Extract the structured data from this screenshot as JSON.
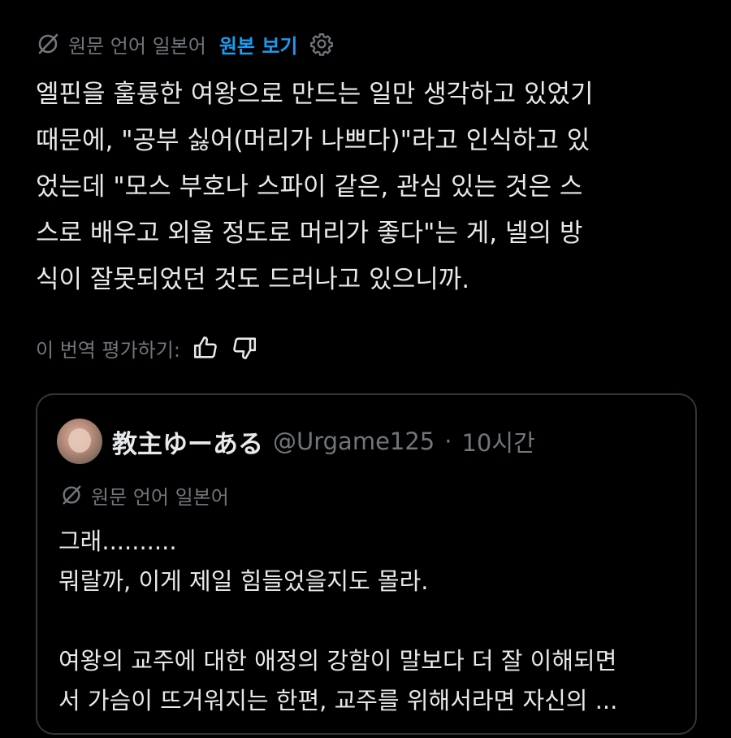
{
  "translation": {
    "source_label": "원문 언어 일본어",
    "show_original": "원본 보기",
    "icon": "translate-off-icon",
    "settings_icon": "gear-icon"
  },
  "tweet": {
    "text": "엘핀을 훌륭한 여왕으로 만드는 일만 생각하고 있었기\n때문에, \"공부 싫어(머리가 나쁘다)\"라고 인식하고 있\n었는데 \"모스 부호나 스파이 같은, 관심 있는 것은 스\n스로 배우고 외울 정도로 머리가 좋다\"는 게, 넬의 방\n식이 잘못되었던 것도 드러나고 있으니까."
  },
  "rating": {
    "label": "이 번역 평가하기:",
    "like_icon": "thumbs-up-icon",
    "dislike_icon": "thumbs-down-icon"
  },
  "quote": {
    "display_name": "教主ゆーある",
    "handle": "@Urgame125",
    "separator": "·",
    "time": "10시간",
    "source_label": "원문 언어 일본어",
    "text": "그래..........\n뭐랄까, 이게 제일 힘들었을지도 몰라.\n\n여왕의 교주에 대한 애정의 강함이 말보다 더 잘 이해되면\n서 가슴이 뜨거워지는 한편, 교주를 위해서라면 자신의 ..."
  },
  "colors": {
    "background": "#000000",
    "text": "#e7e9ea",
    "muted": "#71767b",
    "link": "#1d9bf0",
    "border": "#333639"
  }
}
